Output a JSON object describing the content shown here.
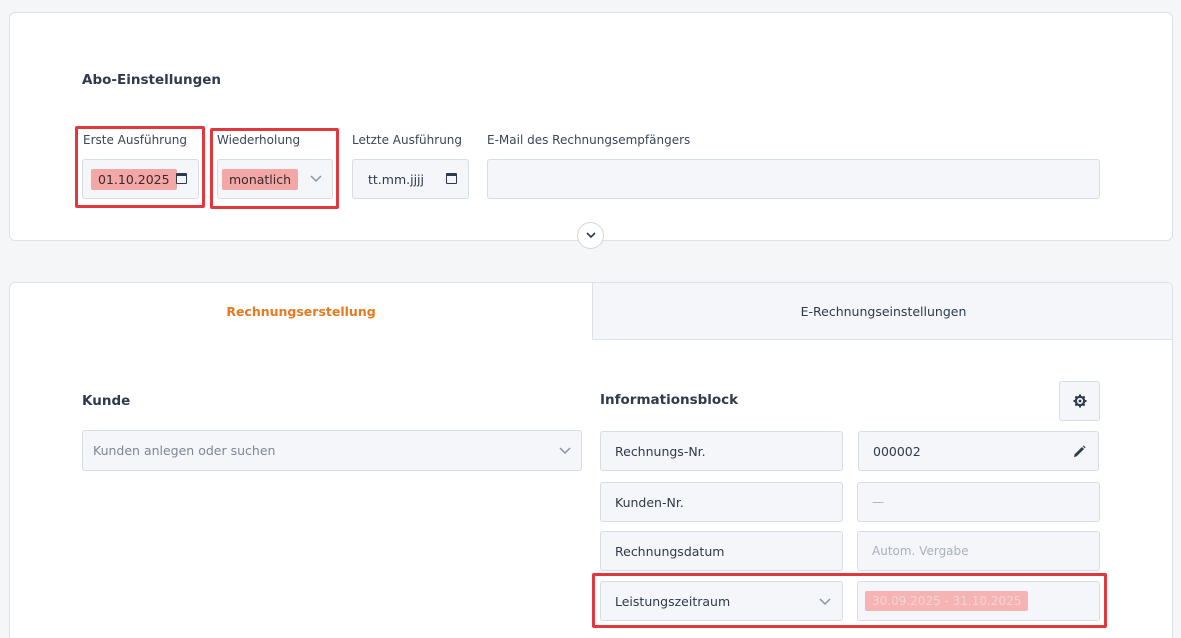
{
  "abo": {
    "title": "Abo-Einstellungen",
    "erste_label": "Erste Ausführung",
    "erste_value": "01.10.2025",
    "wiederholung_label": "Wiederholung",
    "wiederholung_value": "monatlich",
    "letzte_label": "Letzte Ausführung",
    "letzte_placeholder": "tt.mm.jjjj",
    "email_label": "E-Mail des Rechnungsempfängers",
    "email_value": ""
  },
  "tabs": [
    {
      "label": "Rechnungserstellung",
      "active": true
    },
    {
      "label": "E-Rechnungseinstellungen",
      "active": false
    }
  ],
  "kunde": {
    "title": "Kunde",
    "search_placeholder": "Kunden anlegen oder suchen"
  },
  "info": {
    "title": "Informationsblock",
    "rows": [
      {
        "label": "Rechnungs-Nr.",
        "value": "000002"
      },
      {
        "label": "Kunden-Nr.",
        "value": "—"
      },
      {
        "label": "Rechnungsdatum",
        "value": "Autom. Vergabe"
      },
      {
        "label": "Leistungszeitraum",
        "value": "30.09.2025 - 31.10.2025"
      }
    ]
  },
  "colors": {
    "accent": "#e8791c",
    "highlight": "#e2373d",
    "highlight_fill": "#f4a7a7"
  }
}
